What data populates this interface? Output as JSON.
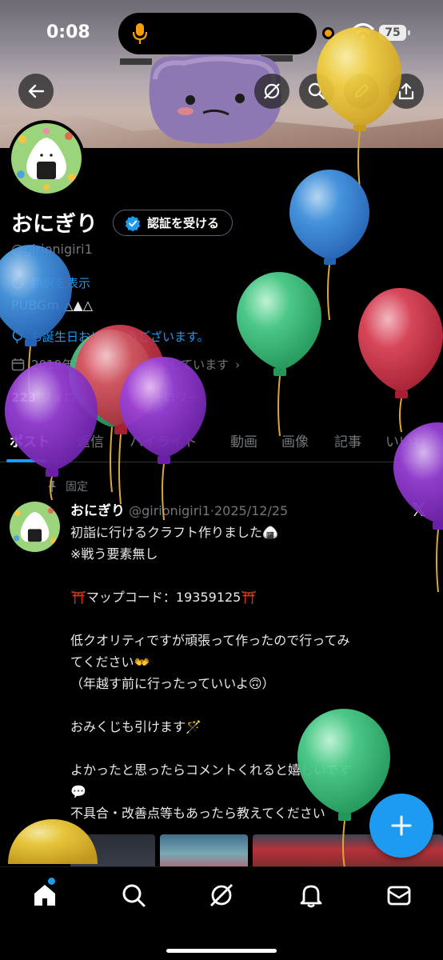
{
  "status_bar": {
    "time": "0:08",
    "battery": "75"
  },
  "header": {
    "back_icon": "arrow-left-icon",
    "grok_icon": "grok-icon",
    "search_icon": "search-icon",
    "edit_icon": "pencil-icon",
    "share_icon": "share-icon"
  },
  "profile": {
    "display_name": "おにぎり",
    "verify_label": "認証を受ける",
    "handle": "@girionigiri1",
    "translate_label": "翻訳を表示",
    "bio": "PUBGm △▲△",
    "birthday": "お誕生日おめでとうございます。",
    "joined": "2019年10月からXを利用しています",
    "following_count": "223",
    "following_label": "フォロー中",
    "followers_count": "33",
    "followers_label": "フォロワー"
  },
  "tabs": [
    "ポスト",
    "返信",
    "ハイライト",
    "動画",
    "画像",
    "記事",
    "いいね"
  ],
  "pinned_post": {
    "pinned_label": "固定",
    "author_name": "おにぎり",
    "author_handle": "@girionigiri1",
    "date": "2025/12/25",
    "lines": [
      "初詣に行けるクラフト作りました🍙",
      "※戦う要素無し",
      "",
      "⛩️マップコード：19359125⛩️",
      "",
      "低クオリティですが頑張って作ったので行ってみ",
      "てください👐",
      "（年越す前に行ったっていいよ🙃）",
      "",
      "おみくじも引けます🪄",
      "",
      "よかったと思ったらコメントくれると嬉しいです",
      "💬",
      "不具合・改善点等もあったら教えてください"
    ]
  },
  "bottom_nav": [
    "home-icon",
    "search-icon",
    "grok-icon",
    "notifications-icon",
    "messages-icon"
  ],
  "colors": {
    "accent": "#1d9bf0",
    "background": "#000000",
    "muted": "#71767b"
  }
}
